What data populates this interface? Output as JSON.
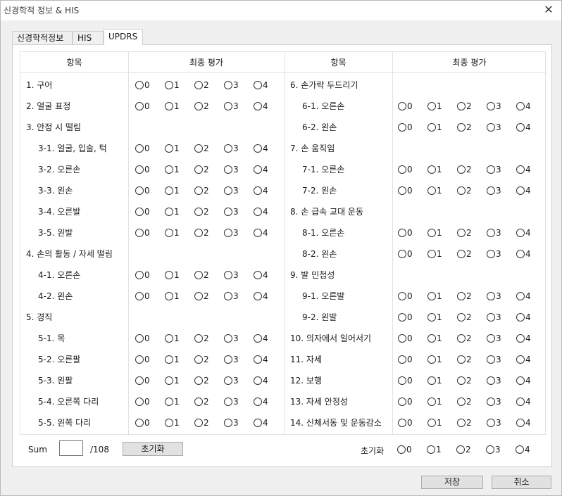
{
  "window": {
    "title": "신경학적 정보 & HIS",
    "close_icon": "close-icon"
  },
  "tabs": [
    {
      "label": "신경학적정보",
      "active": false
    },
    {
      "label": "HIS",
      "active": false
    },
    {
      "label": "UPDRS",
      "active": true
    }
  ],
  "table": {
    "headers": {
      "item_left": "항목",
      "eval_left": "최종 평가",
      "item_right": "항목",
      "eval_right": "최종 평가"
    },
    "options": [
      "0",
      "1",
      "2",
      "3",
      "4"
    ],
    "left_rows": [
      {
        "label": "1. 구어",
        "indent": false,
        "radios": true
      },
      {
        "label": "2. 얼굴 표정",
        "indent": false,
        "radios": true
      },
      {
        "label": "3. 안정 시 떨림",
        "indent": false,
        "radios": false
      },
      {
        "label": "3-1. 얼굴, 입술, 턱",
        "indent": true,
        "radios": true
      },
      {
        "label": "3-2. 오른손",
        "indent": true,
        "radios": true
      },
      {
        "label": "3-3. 왼손",
        "indent": true,
        "radios": true
      },
      {
        "label": "3-4. 오른발",
        "indent": true,
        "radios": true
      },
      {
        "label": "3-5. 왼발",
        "indent": true,
        "radios": true
      },
      {
        "label": "4. 손의 활동 / 자세 떨림",
        "indent": false,
        "radios": false
      },
      {
        "label": "4-1. 오른손",
        "indent": true,
        "radios": true
      },
      {
        "label": "4-2. 왼손",
        "indent": true,
        "radios": true
      },
      {
        "label": "5. 경직",
        "indent": false,
        "radios": false
      },
      {
        "label": "5-1. 목",
        "indent": true,
        "radios": true
      },
      {
        "label": "5-2. 오른팔",
        "indent": true,
        "radios": true
      },
      {
        "label": "5-3. 왼팔",
        "indent": true,
        "radios": true
      },
      {
        "label": "5-4. 오른쪽 다리",
        "indent": true,
        "radios": true
      },
      {
        "label": "5-5. 왼쪽 다리",
        "indent": true,
        "radios": true
      }
    ],
    "right_rows": [
      {
        "label": "6. 손가락 두드리기",
        "indent": false,
        "radios": false
      },
      {
        "label": "6-1. 오른손",
        "indent": true,
        "radios": true
      },
      {
        "label": "6-2. 왼손",
        "indent": true,
        "radios": true
      },
      {
        "label": "7. 손 움직임",
        "indent": false,
        "radios": false
      },
      {
        "label": "7-1. 오른손",
        "indent": true,
        "radios": true
      },
      {
        "label": "7-2. 왼손",
        "indent": true,
        "radios": true
      },
      {
        "label": "8. 손 급속 교대 운동",
        "indent": false,
        "radios": false
      },
      {
        "label": "8-1. 오른손",
        "indent": true,
        "radios": true
      },
      {
        "label": "8-2. 왼손",
        "indent": true,
        "radios": true
      },
      {
        "label": "9. 발 민첩성",
        "indent": false,
        "radios": false
      },
      {
        "label": "9-1. 오른발",
        "indent": true,
        "radios": true
      },
      {
        "label": "9-2. 왼발",
        "indent": true,
        "radios": true
      },
      {
        "label": "10. 의자에서 일어서기",
        "indent": false,
        "radios": true
      },
      {
        "label": "11. 자세",
        "indent": false,
        "radios": true
      },
      {
        "label": "12. 보행",
        "indent": false,
        "radios": true
      },
      {
        "label": "13. 자세 안정성",
        "indent": false,
        "radios": true
      },
      {
        "label": "14. 신체서동 및 운동감소",
        "indent": false,
        "radios": true
      }
    ]
  },
  "footer": {
    "sum_label": "Sum",
    "sum_value": "",
    "sum_max": "/108",
    "reset_button": "초기화",
    "reset_all_label": "초기화"
  },
  "buttons": {
    "save": "저장",
    "cancel": "취소"
  }
}
